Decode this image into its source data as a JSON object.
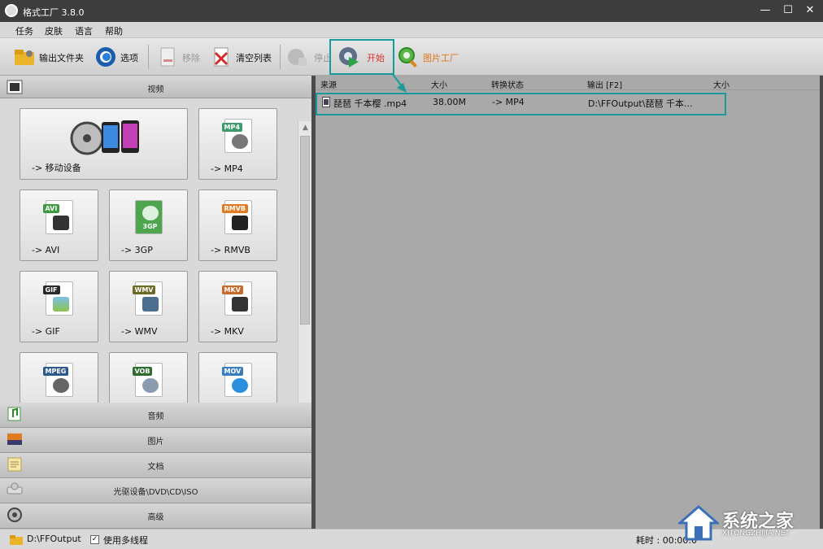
{
  "window": {
    "title": "格式工厂 3.8.0",
    "minimize": "—",
    "maximize": "☐",
    "close": "✕"
  },
  "menu": [
    "任务",
    "皮肤",
    "语言",
    "帮助"
  ],
  "toolbar": {
    "output_folder": "输出文件夹",
    "options": "选项",
    "remove": "移除",
    "clear_list": "清空列表",
    "stop": "停止",
    "start": "开始",
    "picture_factory": "图片工厂"
  },
  "left": {
    "video_header": "视频",
    "formats": [
      {
        "label": "-> 移动设备",
        "tag": ""
      },
      {
        "label": "-> MP4",
        "tag": "MP4"
      },
      {
        "label": "-> AVI",
        "tag": "AVI"
      },
      {
        "label": "-> 3GP",
        "tag": "3GP"
      },
      {
        "label": "-> RMVB",
        "tag": "RMVB"
      },
      {
        "label": "-> GIF",
        "tag": "GIF"
      },
      {
        "label": "-> WMV",
        "tag": "WMV"
      },
      {
        "label": "-> MKV",
        "tag": "MKV"
      },
      {
        "label": "",
        "tag": "MPEG"
      },
      {
        "label": "",
        "tag": "VOB"
      },
      {
        "label": "",
        "tag": "MOV"
      }
    ],
    "categories": [
      "音频",
      "图片",
      "文档",
      "光驱设备\\DVD\\CD\\ISO",
      "高级"
    ]
  },
  "list": {
    "headers": [
      "来源",
      "大小",
      "转换状态",
      "输出 [F2]",
      "大小"
    ],
    "rows": [
      {
        "source": "琵琶 千本樱 .mp4",
        "size": "38.00M",
        "status": "-> MP4",
        "output": "D:\\FFOutput\\琵琶 千本..."
      }
    ]
  },
  "status": {
    "folder": "D:\\FFOutput",
    "multithread": "使用多线程",
    "elapsed": "耗时 : 00:00:0"
  },
  "watermark": {
    "text": "系统之家",
    "sub": "XITONGZHIJIA.NET"
  },
  "colors": {
    "highlight": "#1a9a9a",
    "start_label": "#d9342b"
  }
}
